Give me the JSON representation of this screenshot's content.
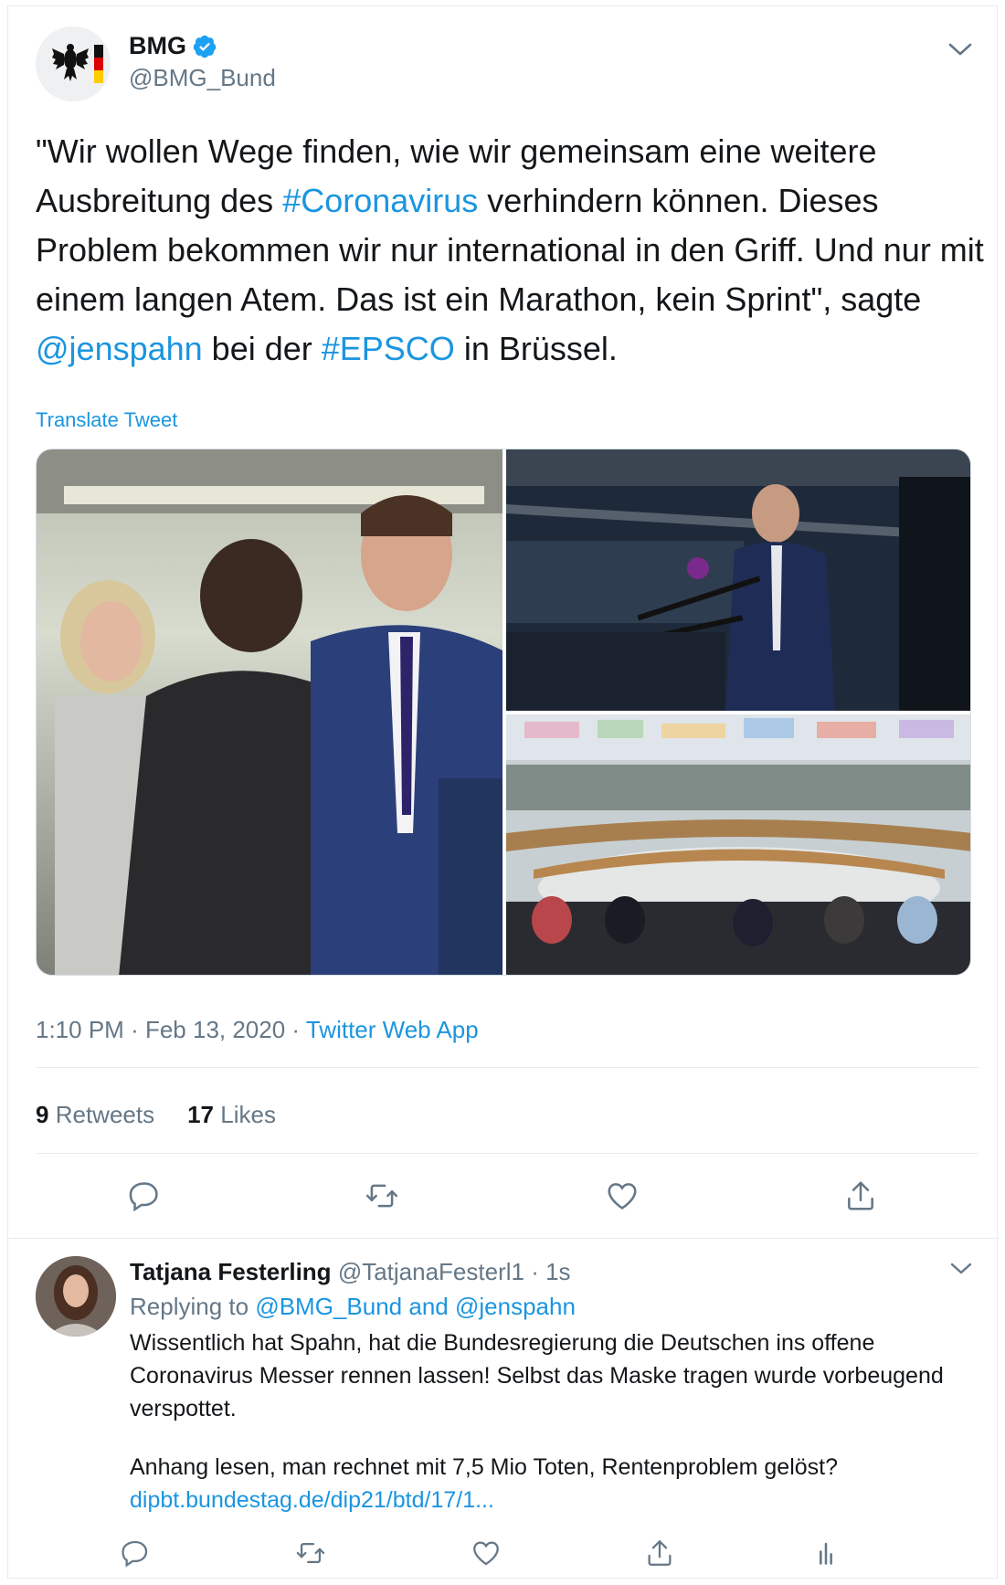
{
  "tweet": {
    "author_name": "BMG",
    "author_handle": "@BMG_Bund",
    "text_parts": [
      {
        "t": "\"Wir wollen Wege finden, wie wir gemeinsam eine weitere Ausbreitung des "
      },
      {
        "t": "#Coronavirus",
        "link": true
      },
      {
        "t": " verhindern können. Dieses Problem bekommen wir nur international in den Griff. Und nur mit einem langen Atem. Das ist ein Marathon, kein Sprint\", sagte "
      },
      {
        "t": "@jenspahn",
        "link": true
      },
      {
        "t": " bei der "
      },
      {
        "t": "#EPSCO",
        "link": true
      },
      {
        "t": " in Brüssel."
      }
    ],
    "translate_label": "Translate Tweet",
    "time": "1:10 PM",
    "date": "Feb 13, 2020",
    "source": "Twitter Web App",
    "retweets_count": "9",
    "retweets_label": "Retweets",
    "likes_count": "17",
    "likes_label": "Likes"
  },
  "reply": {
    "author_name": "Tatjana Festerling",
    "author_handle": "@TatjanaFesterl1",
    "time_ago": "1s",
    "replying_label": "Replying to",
    "replying_to_1": "@BMG_Bund",
    "replying_and": "and",
    "replying_to_2": "@jenspahn",
    "body_1": "Wissentlich hat Spahn, hat die Bundesregierung die Deutschen ins offene Coronavirus Messer rennen lassen! Selbst das Maske tragen wurde vorbeugend verspottet.",
    "body_2": "Anhang lesen, man rechnet mit 7,5 Mio Toten, Rentenproblem gelöst?",
    "link": "dipbt.bundestag.de/dip21/btd/17/1..."
  },
  "colors": {
    "link": "#1b95e0",
    "secondary": "#657786",
    "text": "#14171a",
    "border": "#e6ecf0"
  },
  "icons": [
    "verified-badge-icon",
    "chevron-down-icon",
    "reply-icon",
    "retweet-icon",
    "like-icon",
    "share-icon",
    "analytics-icon"
  ]
}
